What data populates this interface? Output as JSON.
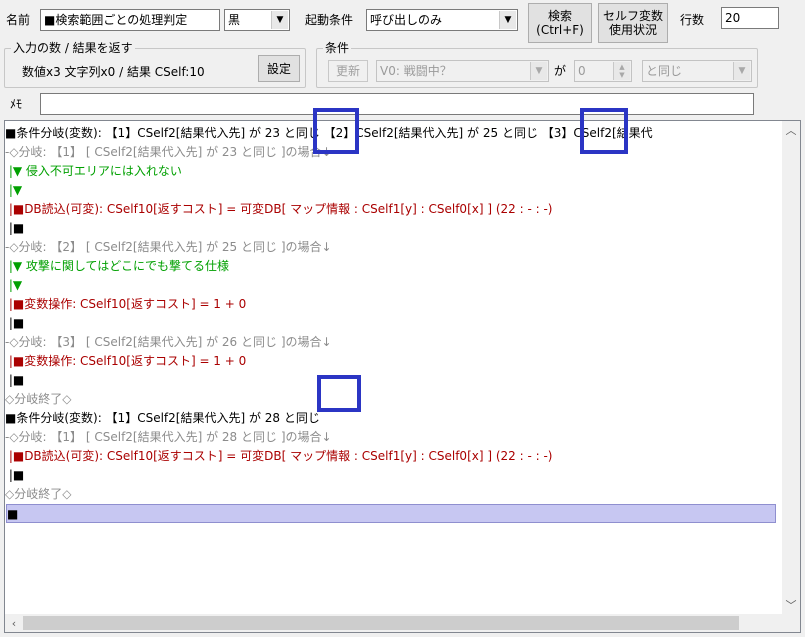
{
  "top": {
    "name_label": "名前",
    "name_value": "■検索範囲ごとの処理判定",
    "color_value": "黒",
    "trigger_label": "起動条件",
    "trigger_value": "呼び出しのみ",
    "search_button": "検索\n(Ctrl+F)",
    "self_var_button": "セルフ変数\n使用状況",
    "rows_label": "行数",
    "rows_value": "20"
  },
  "io_group": {
    "title": "入力の数 / 結果を返す",
    "text": "数値x3 文字列x0 / 結果 CSelf:10",
    "settings_button": "設定"
  },
  "cond_group": {
    "title": "条件",
    "update_button": "更新",
    "var_value": "V0: 戦闘中？",
    "ga_label": "が",
    "num_value": "0",
    "op_value": "と同じ"
  },
  "memo": {
    "label": "ﾒﾓ",
    "value": ""
  },
  "editor": {
    "lines": [
      {
        "text": "■条件分岐(変数): 【1】CSelf2[結果代入先] が 23 と同じ 【2】CSelf2[結果代入先] が 25 と同じ 【3】CSelf2[結果代",
        "color": "black"
      },
      {
        "text": "-◇分岐: 【1】 [ CSelf2[結果代入先] が 23 と同じ ]の場合↓",
        "color": "gray"
      },
      {
        "text": " |▼ 侵入不可エリアには入れない",
        "color": "green"
      },
      {
        "text": " |▼",
        "color": "green"
      },
      {
        "text": " |■DB読込(可変): CSelf10[返すコスト] = 可変DB[ マップ情報 : CSelf1[y] : CSelf0[x] ] (22 : - : -)",
        "color": "red"
      },
      {
        "text": " |■",
        "color": "black"
      },
      {
        "text": "-◇分岐: 【2】 [ CSelf2[結果代入先] が 25 と同じ ]の場合↓",
        "color": "gray"
      },
      {
        "text": " |▼ 攻撃に関してはどこにでも撃てる仕様",
        "color": "green"
      },
      {
        "text": " |▼",
        "color": "green"
      },
      {
        "text": " |■変数操作: CSelf10[返すコスト] = 1 + 0",
        "color": "red"
      },
      {
        "text": " |■",
        "color": "black"
      },
      {
        "text": "-◇分岐: 【3】 [ CSelf2[結果代入先] が 26 と同じ ]の場合↓",
        "color": "gray"
      },
      {
        "text": " |■変数操作: CSelf10[返すコスト] = 1 + 0",
        "color": "red"
      },
      {
        "text": " |■",
        "color": "black"
      },
      {
        "text": "◇分岐終了◇",
        "color": "gray"
      },
      {
        "text": "■条件分岐(変数): 【1】CSelf2[結果代入先] が 28 と同じ",
        "color": "black"
      },
      {
        "text": "-◇分岐: 【1】 [ CSelf2[結果代入先] が 28 と同じ ]の場合↓",
        "color": "gray"
      },
      {
        "text": " |■DB読込(可変): CSelf10[返すコスト] = 可変DB[ マップ情報 : CSelf1[y] : CSelf0[x] ] (22 : - : -)",
        "color": "red"
      },
      {
        "text": " |■",
        "color": "black"
      },
      {
        "text": "◇分岐終了◇",
        "color": "gray"
      },
      {
        "text": "■",
        "color": "black",
        "selected": true
      }
    ]
  },
  "icons": {
    "dropdown": "chevron-down-icon",
    "spin": "spin-updown-icon",
    "scroll_up": "scroll-up-icon",
    "scroll_down": "scroll-down-icon",
    "scroll_left": "scroll-left-icon"
  },
  "colors": {
    "highlight_box": "#2b35c4",
    "comment_green": "#00a000",
    "command_red": "#aa0000",
    "branch_gray": "#8c8c8c",
    "selected_line": "#c7c7f2"
  }
}
